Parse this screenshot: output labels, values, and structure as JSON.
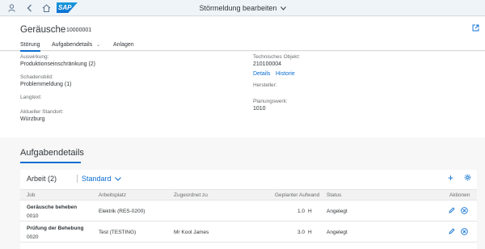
{
  "shell": {
    "title": "Störmeldung bearbeiten",
    "logo": "SAP",
    "icons": [
      "user-icon",
      "back-icon",
      "home-icon",
      "chevron-down-icon"
    ]
  },
  "header": {
    "title": "Geräusche",
    "id": "10000001",
    "export_icon": "export-icon"
  },
  "tabs": [
    {
      "label": "Störung",
      "active": true
    },
    {
      "label": "Aufgabendetails",
      "active": false,
      "has_dropdown": true
    },
    {
      "label": "Anlagen",
      "active": false
    }
  ],
  "details": {
    "auswirkung_label": "Auswirkung:",
    "auswirkung_value": "Produktionseinschränkung (2)",
    "schadensbild_label": "Schadensbild:",
    "schadensbild_value": "Problemmeldung (1)",
    "langtext_label": "Langtext:",
    "standort_label": "Aktueller Standort:",
    "standort_value": "Würzburg",
    "techobj_label": "Technisches Objekt:",
    "techobj_value": "210100004",
    "details_link": "Details",
    "historie_link": "Historie",
    "hersteller_label": "Hersteller:",
    "planungswerk_label": "Planungswerk:",
    "planungswerk_value": "1010"
  },
  "section": {
    "title": "Aufgabendetails"
  },
  "table": {
    "title": "Arbeit (2)",
    "variant": "Standard",
    "columns": [
      "Job",
      "Arbeitsplatz",
      "Zugeordnet zu",
      "Geplanter Aufwand",
      "Status",
      "Aktionen"
    ],
    "rows": [
      {
        "job": "Geräusche beheben",
        "job_nr": "0010",
        "arbeitsplatz": "Elektrik (RES-0200)",
        "zugeordnet": "",
        "aufwand": "1.0",
        "einheit": "H",
        "status": "Angelegt"
      },
      {
        "job": "Prüfung der Behebung",
        "job_nr": "0020",
        "arbeitsplatz": "Test (TESTING)",
        "zugeordnet": "Mr Kool James",
        "aufwand": "3.0",
        "einheit": "H",
        "status": "Angelegt"
      }
    ]
  },
  "colors": {
    "accent": "#0a6ed1",
    "shell_bg": "#eff4f9",
    "page_bg": "#f7f7f7"
  }
}
